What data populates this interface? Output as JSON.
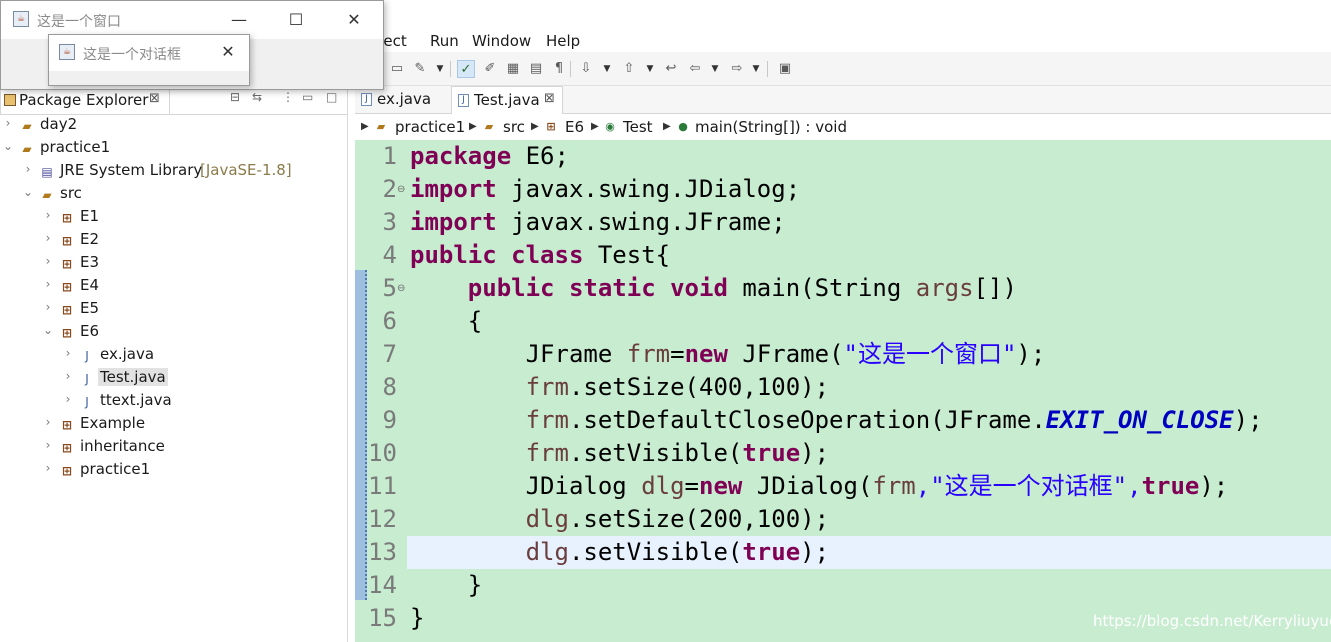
{
  "menu": {
    "partial": "oject",
    "run": "Run",
    "window": "Window",
    "help": "Help"
  },
  "explorer": {
    "tab_label": "Package Explorer",
    "close_glyph": "⊠",
    "tree": [
      {
        "label": "day2",
        "icon": "project-folder-icon"
      },
      {
        "label": "practice1",
        "icon": "project-folder-icon"
      },
      {
        "label": "JRE System Library",
        "decoration": "[JavaSE-1.8]",
        "icon": "library-icon"
      },
      {
        "label": "src",
        "icon": "source-folder-icon"
      },
      {
        "label": "E1",
        "icon": "package-icon"
      },
      {
        "label": "E2",
        "icon": "package-icon"
      },
      {
        "label": "E3",
        "icon": "package-icon"
      },
      {
        "label": "E4",
        "icon": "package-icon"
      },
      {
        "label": "E5",
        "icon": "package-icon"
      },
      {
        "label": "E6",
        "icon": "package-icon"
      },
      {
        "label": "ex.java",
        "icon": "java-file-icon"
      },
      {
        "label": "Test.java",
        "icon": "java-file-icon",
        "selected": true
      },
      {
        "label": "ttext.java",
        "icon": "java-file-icon"
      },
      {
        "label": "Example",
        "icon": "package-icon"
      },
      {
        "label": "inheritance",
        "icon": "package-icon"
      },
      {
        "label": "practice1",
        "icon": "package-icon"
      }
    ]
  },
  "editor": {
    "tabs": [
      {
        "label": "ex.java",
        "active": false
      },
      {
        "label": "Test.java",
        "active": true
      }
    ],
    "tab_close_glyph": "⊠",
    "breadcrumb": [
      "practice1",
      "src",
      "E6",
      "Test",
      "main(String[]) : void"
    ],
    "line_numbers": [
      "1",
      "2",
      "3",
      "4",
      "5",
      "6",
      "7",
      "8",
      "9",
      "10",
      "11",
      "12",
      "13",
      "14",
      "15"
    ],
    "current_line": 13
  },
  "code": {
    "l1": {
      "kw": "package",
      "rest": " E6;"
    },
    "l2": {
      "kw": "import",
      "rest": " javax.swing.JDialog;"
    },
    "l3": {
      "kw": "import",
      "rest": " javax.swing.JFrame;"
    },
    "l4": {
      "kw1": "public",
      "kw2": "class",
      "rest": " Test{"
    },
    "l5": {
      "indent": "    ",
      "kw1": "public",
      "kw2": "static",
      "kw3": "void",
      "mid": " main(String ",
      "var": "args",
      "rest": "[])"
    },
    "l6": {
      "text": "    {"
    },
    "l7": {
      "indent": "        ",
      "a": "JFrame ",
      "var": "frm",
      "b": "=",
      "kw": "new",
      "c": " JFrame(",
      "str": "\"这是一个窗口\"",
      "d": ");"
    },
    "l8": {
      "indent": "        ",
      "var": "frm",
      "rest": ".setSize(400,100);"
    },
    "l9": {
      "indent": "        ",
      "var": "frm",
      "a": ".setDefaultCloseOperation(JFrame.",
      "fld": "EXIT_ON_CLOSE",
      "b": ");"
    },
    "l10": {
      "indent": "        ",
      "var": "frm",
      "a": ".setVisible(",
      "kw": "true",
      "b": ");"
    },
    "l11": {
      "indent": "        ",
      "a": "JDialog ",
      "var": "dlg",
      "b": "=",
      "kw": "new",
      "c": " JDialog(",
      "var2": "frm",
      "str": ",\"这是一个对话框\",",
      "kw2": "true",
      "d": ");"
    },
    "l12": {
      "indent": "        ",
      "var": "dlg",
      "rest": ".setSize(200,100);"
    },
    "l13": {
      "indent": "        ",
      "var": "dlg",
      "a": ".setVisible(",
      "kw": "true",
      "b": ");"
    },
    "l14": {
      "text": "    }"
    },
    "l15": {
      "text": "}"
    }
  },
  "frame_window": {
    "title": "这是一个窗口",
    "minimize": "—",
    "maximize": "☐",
    "close": "✕"
  },
  "dialog_window": {
    "title": "这是一个对话框",
    "close": "✕"
  },
  "watermark": "https://blog.csdn.net/Kerryliuyue"
}
